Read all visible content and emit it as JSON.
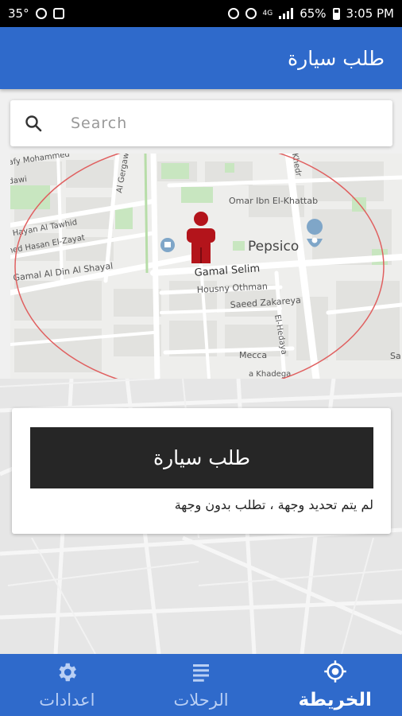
{
  "status_bar": {
    "temperature": "35°",
    "battery": "65%",
    "time": "3:05 PM",
    "network": "4G"
  },
  "app_bar": {
    "title": "طلب سيارة"
  },
  "search": {
    "placeholder": "Search",
    "value": ""
  },
  "map": {
    "streets": [
      "afy Mohammed",
      "dawi",
      "Al Gergawi",
      "Khedr",
      "Omar Ibn El-Khattab",
      "Pepsico",
      "u Hayan Al Tawhid",
      "med Hasan El-Zayat",
      "Gamal Al Din Al Shayal",
      "Gamal Selim",
      "Housny Othman",
      "Saeed Zakareya",
      "El-Hedaya",
      "Mecca",
      "a Khadega",
      "Sa"
    ],
    "pin_icon": "person-pin-icon",
    "pin_color": "#b3141b",
    "radius_color": "#e06060"
  },
  "request_card": {
    "button_label": "طلب سيارة",
    "hint": "لم يتم تحديد وجهة ، تطلب بدون وجهة"
  },
  "bottom_nav": {
    "items": [
      {
        "label": "اعدادات",
        "icon": "gear-icon",
        "active": false
      },
      {
        "label": "الرحلات",
        "icon": "list-icon",
        "active": false
      },
      {
        "label": "الخريطة",
        "icon": "location-target-icon",
        "active": true
      }
    ]
  },
  "colors": {
    "primary": "#2f6acb",
    "button": "#262626"
  }
}
